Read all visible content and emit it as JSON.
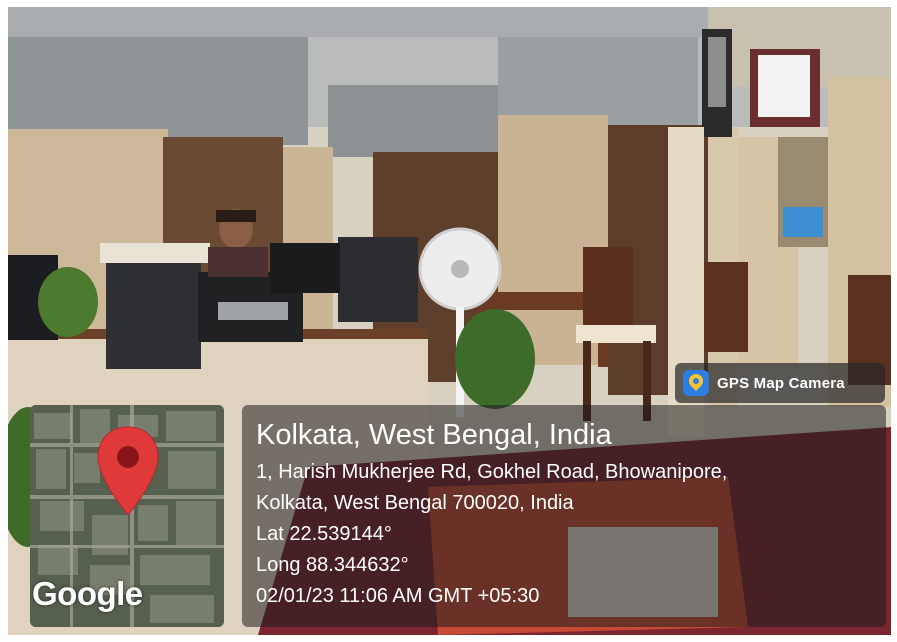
{
  "badge": {
    "app_name": "GPS Map Camera",
    "icon": "map-pin-icon",
    "icon_color": "#2e7de0",
    "pin_color": "#f7c531"
  },
  "map": {
    "logo_text": "Google",
    "marker_icon": "map-marker-icon",
    "marker_color": "#e0393a"
  },
  "location": {
    "title": "Kolkata, West Bengal, India",
    "address_line_1": "1, Harish Mukherjee Rd, Gokhel Road, Bhowanipore,",
    "address_line_2": "Kolkata, West Bengal 700020, India",
    "latitude": "Lat 22.539144°",
    "longitude": "Long 88.344632°",
    "datetime": "02/01/23 11:06 AM GMT +05:30"
  }
}
